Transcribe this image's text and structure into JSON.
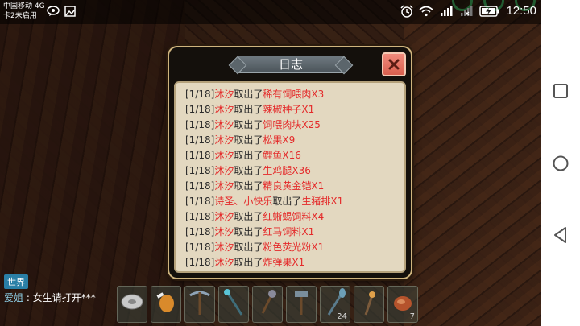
{
  "status_bar": {
    "carrier_line1": "中国移动 4G",
    "carrier_line2": "卡2未启用",
    "time": "12:50",
    "network_label": "4G"
  },
  "dialog": {
    "title": "日志",
    "close_icon": "close-x-icon",
    "entries": [
      {
        "prefix": "[1/18]",
        "actor": "沐汐",
        "verb": "取出了",
        "item": "稀有饲喂肉X3"
      },
      {
        "prefix": "[1/18]",
        "actor": "沐汐",
        "verb": "取出了",
        "item": "辣椒种子X1"
      },
      {
        "prefix": "[1/18]",
        "actor": "沐汐",
        "verb": "取出了",
        "item": "饲喂肉块X25"
      },
      {
        "prefix": "[1/18]",
        "actor": "沐汐",
        "verb": "取出了",
        "item": "松果X9"
      },
      {
        "prefix": "[1/18]",
        "actor": "沐汐",
        "verb": "取出了",
        "item": "鲤鱼X16"
      },
      {
        "prefix": "[1/18]",
        "actor": "沐汐",
        "verb": "取出了",
        "item": "生鸡腿X36"
      },
      {
        "prefix": "[1/18]",
        "actor": "沐汐",
        "verb": "取出了",
        "item": "精良黄金铠X1"
      },
      {
        "prefix": "[1/18]",
        "actor": "诗圣、小快乐",
        "verb": "取出了",
        "item": "生猪排X1"
      },
      {
        "prefix": "[1/18]",
        "actor": "沐汐",
        "verb": "取出了",
        "item": "红蜥蜴饲料X4"
      },
      {
        "prefix": "[1/18]",
        "actor": "沐汐",
        "verb": "取出了",
        "item": "红马饲料X1"
      },
      {
        "prefix": "[1/18]",
        "actor": "沐汐",
        "verb": "取出了",
        "item": "粉色荧光粉X1"
      },
      {
        "prefix": "[1/18]",
        "actor": "沐汐",
        "verb": "取出了",
        "item": "炸弹果X1"
      }
    ]
  },
  "chat": {
    "channel": "世界",
    "sender": "爱姐",
    "separator": " : ",
    "message": "女生请打开***"
  },
  "hotbar": {
    "slots": [
      {
        "icon": "disc-item-icon",
        "count": ""
      },
      {
        "icon": "roast-meat-icon",
        "count": ""
      },
      {
        "icon": "pickaxe-icon",
        "count": ""
      },
      {
        "icon": "staff-icon",
        "count": ""
      },
      {
        "icon": "mace-icon",
        "count": ""
      },
      {
        "icon": "hammer-icon",
        "count": ""
      },
      {
        "icon": "shovel-icon",
        "count": "24"
      },
      {
        "icon": "torch-icon",
        "count": ""
      },
      {
        "icon": "meat-chunk-icon",
        "count": "7"
      }
    ]
  },
  "colors": {
    "accent_red": "#e42a2a",
    "log_bg": "#e3d8c0",
    "dialog_border": "#cfb47e",
    "close_btn": "#e07060",
    "chat_tag": "#2a7fa6"
  }
}
